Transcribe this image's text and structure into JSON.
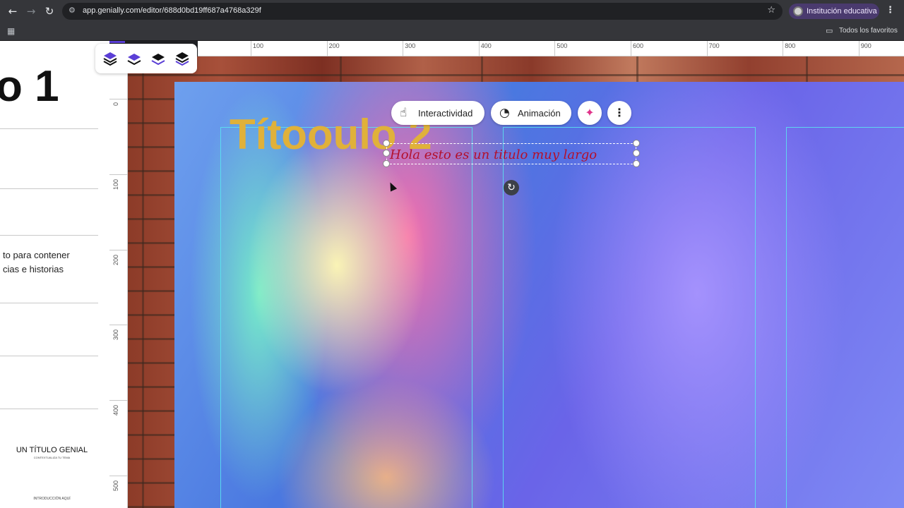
{
  "browser": {
    "url": "app.genially.com/editor/688d0bd19ff687a4768a329f",
    "profile_label": "Institución educativa",
    "bookmark_folder_label": "Todos los favoritos",
    "icons": [
      "back-arrow-icon",
      "forward-arrow-icon",
      "reload-icon",
      "site-settings-icon",
      "star-icon",
      "kebab-menu-icon",
      "apps-grid-icon",
      "folder-icon"
    ]
  },
  "slides_panel": {
    "big_title_fragment": "o 1",
    "text_line_1": "to para contener",
    "text_line_2": "cias e historias",
    "thumb_title": "UN TÍTULO GENIAL",
    "thumb_subtitle": "CONTEXTUALIZA TU TEMA",
    "thumb_intro": "INTRODUCCIÓN AQUÍ"
  },
  "layer_toolbar": {
    "buttons": [
      "bring-to-front-icon",
      "bring-forward-icon",
      "send-backward-icon",
      "send-to-back-icon"
    ],
    "accent_color": "#5b3fd6"
  },
  "ruler": {
    "top_labels": [
      "100",
      "200",
      "300",
      "400",
      "500",
      "600",
      "700",
      "800",
      "900"
    ],
    "left_labels": [
      "0",
      "100",
      "200",
      "300",
      "400",
      "500"
    ]
  },
  "element_toolbar": {
    "interactivity_label": "Interactividad",
    "animation_label": "Animación",
    "ai_icon": "sparkle-icon",
    "more_icon": "kebab-menu-icon"
  },
  "slide": {
    "title": "Títooulo 2",
    "title_color": "#e0b13a",
    "selected_text": "Hola esto es un titulo muy largo",
    "selected_text_color": "#b3102c"
  }
}
